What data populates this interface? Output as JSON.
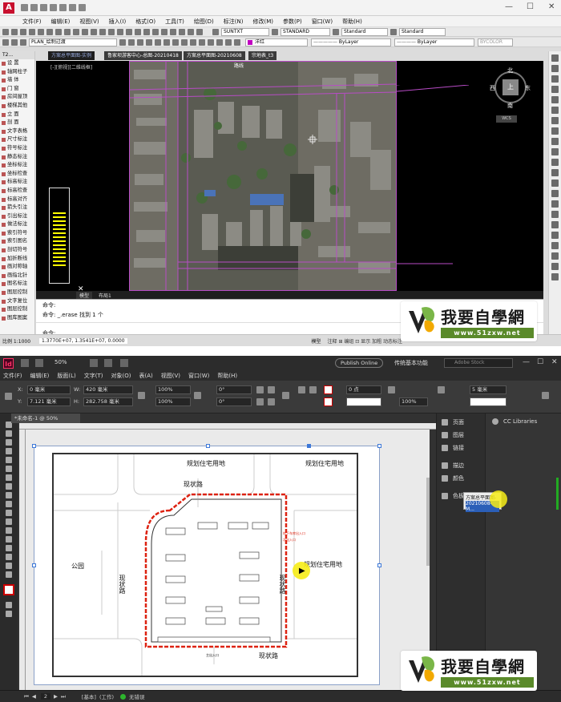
{
  "autocad": {
    "menu": [
      "文件(F)",
      "编辑(E)",
      "视图(V)",
      "插入(I)",
      "格式(O)",
      "工具(T)",
      "绘图(D)",
      "标注(N)",
      "修改(M)",
      "参数(P)",
      "窗口(W)",
      "帮助(H)"
    ],
    "layer_dropdown": "PLAN_绘制过渡",
    "color_dropdown": "洋红",
    "linetype_dropdown": "ByLayer",
    "lineweight_dropdown": "ByLayer",
    "textstyle_dropdown": "SUNTXT",
    "dimstyle_dropdown": "STANDARD",
    "tablestyle_dropdown": "Standard",
    "mleader_dropdown": "Standard",
    "plotstyle_dropdown": "BYCOLOR",
    "left_panel_title": "T2...",
    "left_panel_items": [
      "设 置",
      "轴网柱子",
      "墙 体",
      "门 窗",
      "房间屋顶",
      "楼梯其他",
      "立 面",
      "剖 面",
      "文字表格",
      "尺寸标注",
      "符号标注",
      "静态标注",
      "坐标标注",
      "坐标检查",
      "标高标注",
      "标高检查",
      "标高对齐",
      "箭头引注",
      "引出标注",
      "做法标注",
      "索引符号",
      "索引图名",
      "剖切符号",
      "加折断线",
      "画对称轴",
      "画指北针",
      "图名标注",
      "图层控制",
      "文字复位",
      "图层控制",
      "图库图案"
    ],
    "doc_tabs": [
      "方案总平面图-实例",
      "鲁家坝游客中心-总图-20210418",
      "方案总平面图-20210608",
      "宗地表_t3"
    ],
    "view_label": "[-][俯视][二维线框]",
    "viewcube": {
      "north": "北",
      "south": "南",
      "east": "东",
      "west": "西",
      "top": "上",
      "wcs": "WCS"
    },
    "road_label": "路线",
    "layout_tabs": [
      "模型",
      "布局1"
    ],
    "command_lines": [
      "命令:",
      "命令: _.erase 找到 1 个",
      "命令:"
    ],
    "status_scale": "比例 1:1000",
    "status_coords": "1.3770E+07, 1.3541E+07, 0.0000",
    "status_right": "模型",
    "status_right_icons": "注释 ⊞ 编组 ⊡ 显示 加粗 动态标注"
  },
  "watermark": {
    "brand": "我要自學網",
    "url": "www.51zxw.net"
  },
  "indesign": {
    "logo": "Id",
    "zoom": "50%",
    "publish_button": "Publish Online",
    "workspace": "传统基本功能",
    "search_placeholder": "Adobe Stock",
    "menu": [
      "文件(F)",
      "编辑(E)",
      "版面(L)",
      "文字(T)",
      "对象(O)",
      "表(A)",
      "视图(V)",
      "窗口(W)",
      "帮助(H)"
    ],
    "x_label": "X:",
    "x_value": "0 毫米",
    "y_label": "Y:",
    "y_value": "7.121 毫米",
    "w_label": "W:",
    "w_value": "420 毫米",
    "h_label": "H:",
    "h_value": "282.758 毫米",
    "scale_x": "100%",
    "scale_y": "100%",
    "rotate": "0°",
    "shear": "0°",
    "stroke": "0 点",
    "opacity": "100%",
    "size_field": "5 毫米",
    "doc_tab": "*未命名-1 @ 50%",
    "panels": [
      {
        "icon": "pages",
        "label": "页面"
      },
      {
        "icon": "layers",
        "label": "图层"
      },
      {
        "icon": "links",
        "label": "链接"
      },
      {
        "icon": "stroke",
        "label": "描边"
      },
      {
        "icon": "color",
        "label": "颜色"
      },
      {
        "icon": "swatches",
        "label": "色板"
      }
    ],
    "cc_libraries": "CC Libraries",
    "drag_tooltip": [
      "方案总平面图-",
      "20210608-M..."
    ],
    "map_labels": {
      "top_left": "规划住宅用地",
      "top_right": "规划住宅用地",
      "road_top": "现状路",
      "park": "公园",
      "road_left": "现状路",
      "road_right": "现状路",
      "right_land": "规划住宅用地",
      "road_bottom": "现状路",
      "entrance_main": "主出入口",
      "entrance_1": "地下车库出入口",
      "entrance_2": "次出入口"
    },
    "status": {
      "page": "2",
      "master": "[基本]",
      "mode": "(工作)",
      "errors": "无错误"
    }
  }
}
